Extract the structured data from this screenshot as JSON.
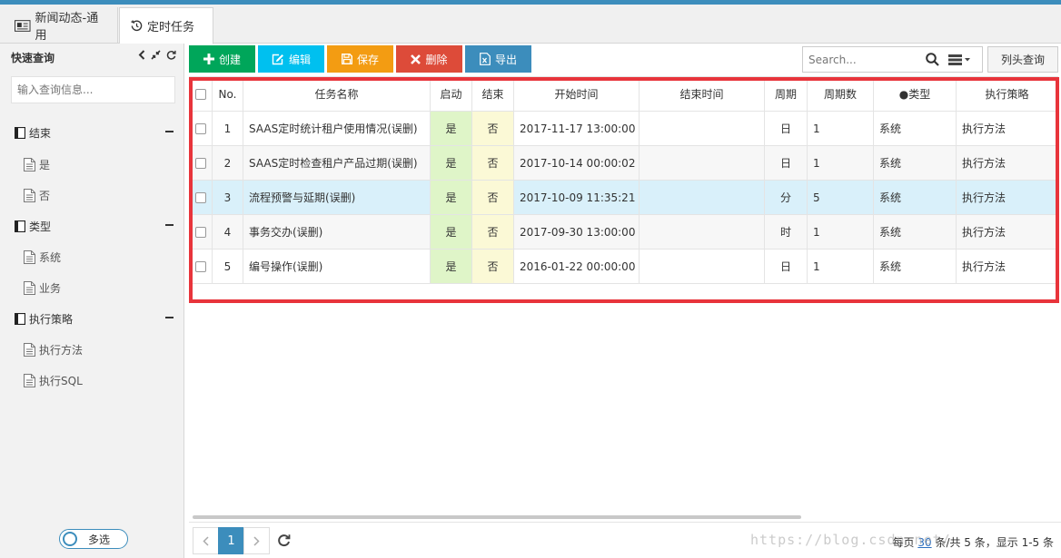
{
  "tabs": [
    {
      "label": "新闻动态-通用"
    },
    {
      "label": "定时任务"
    }
  ],
  "sidebar": {
    "title": "快速查询",
    "search_placeholder": "输入查询信息...",
    "groups": [
      {
        "label": "结束",
        "items": [
          "是",
          "否"
        ]
      },
      {
        "label": "类型",
        "items": [
          "系统",
          "业务"
        ]
      },
      {
        "label": "执行策略",
        "items": [
          "执行方法",
          "执行SQL"
        ]
      }
    ],
    "multi_select_label": "多选"
  },
  "toolbar": {
    "create": "创建",
    "edit": "编辑",
    "save": "保存",
    "delete": "删除",
    "export": "导出",
    "search_placeholder": "Search...",
    "column_query": "列头查询"
  },
  "grid": {
    "columns": [
      "No.",
      "任务名称",
      "启动",
      "结束",
      "开始时间",
      "结束时间",
      "周期",
      "周期数",
      "●类型",
      "执行策略"
    ],
    "rows": [
      {
        "no": "1",
        "name": "SAAS定时统计租户使用情况(误删)",
        "on": "是",
        "end": "否",
        "start": "2017-11-17 13:00:00",
        "finish": "",
        "period": "日",
        "count": "1",
        "type": "系统",
        "strategy": "执行方法"
      },
      {
        "no": "2",
        "name": "SAAS定时检查租户产品过期(误删)",
        "on": "是",
        "end": "否",
        "start": "2017-10-14 00:00:02",
        "finish": "",
        "period": "日",
        "count": "1",
        "type": "系统",
        "strategy": "执行方法"
      },
      {
        "no": "3",
        "name": "流程预警与延期(误删)",
        "on": "是",
        "end": "否",
        "start": "2017-10-09 11:35:21",
        "finish": "",
        "period": "分",
        "count": "5",
        "type": "系统",
        "strategy": "执行方法"
      },
      {
        "no": "4",
        "name": "事务交办(误删)",
        "on": "是",
        "end": "否",
        "start": "2017-09-30 13:00:00",
        "finish": "",
        "period": "时",
        "count": "1",
        "type": "系统",
        "strategy": "执行方法"
      },
      {
        "no": "5",
        "name": "编号操作(误删)",
        "on": "是",
        "end": "否",
        "start": "2016-01-22 00:00:00",
        "finish": "",
        "period": "日",
        "count": "1",
        "type": "系统",
        "strategy": "执行方法"
      }
    ]
  },
  "pager": {
    "current_page": "1",
    "per_page_prefix": "每页",
    "per_page": "30",
    "summary": "条/共 5 条，显示 1-5 条"
  },
  "watermark": "https://blog.csdn.net/",
  "colors": {
    "create": "#00a65a",
    "edit": "#00c0ef",
    "save": "#f39c12",
    "delete": "#dd4b39",
    "export": "#3c8dbc",
    "highlight_box": "#e8343b",
    "selected_row": "#d9f0fa"
  }
}
